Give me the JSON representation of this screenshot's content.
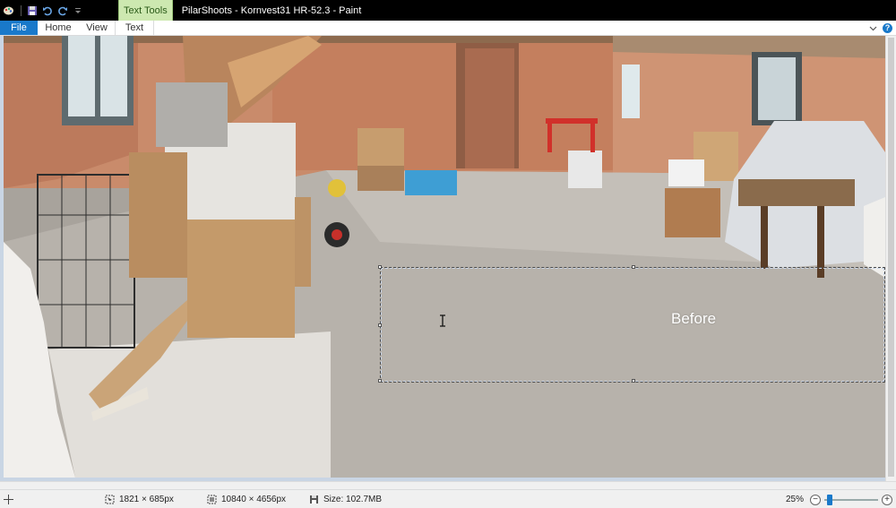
{
  "window": {
    "title": "PilarShoots - Kornvest31 HR-52.3 - Paint",
    "context_tab": "Text Tools"
  },
  "quick_access": {
    "icons": [
      "paint-app-icon",
      "save-icon",
      "undo-icon",
      "redo-icon",
      "customize-icon"
    ]
  },
  "ribbon": {
    "tabs": [
      {
        "label": "File"
      },
      {
        "label": "Home"
      },
      {
        "label": "View"
      },
      {
        "label": "Text"
      }
    ]
  },
  "canvas": {
    "text_box_content": "Before"
  },
  "status": {
    "cursor_position": "1821 × 685px",
    "selection_size": "10840 × 4656px",
    "file_size": "Size: 102.7MB",
    "zoom_label": "25%",
    "zoom_level": 0.25,
    "zoom_slider_fraction": 0.05
  },
  "colors": {
    "file_tab": "#1979ca",
    "context_tab_bg": "#cde8b0",
    "titlebar": "#000000"
  }
}
